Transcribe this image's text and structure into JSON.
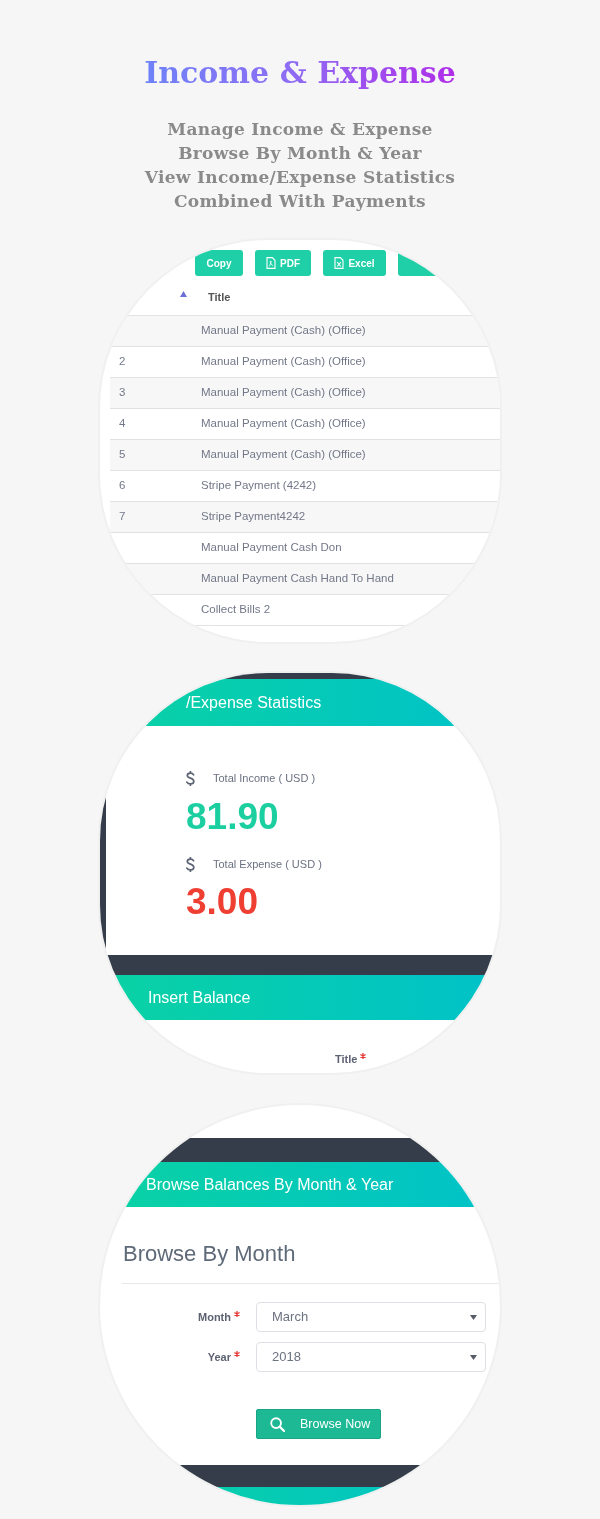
{
  "header": {
    "title": "Income & Expense",
    "features": [
      "Manage Income & Expense",
      "Browse By Month & Year",
      "View Income/Expense Statistics",
      "Combined With Payments"
    ]
  },
  "payments": {
    "toolbar": [
      {
        "kind": "copy",
        "label": "Copy"
      },
      {
        "kind": "pdf",
        "label": "PDF"
      },
      {
        "kind": "excel",
        "label": "Excel"
      },
      {
        "kind": "partial"
      }
    ],
    "columns": [
      {
        "sort_ascending": true
      },
      {
        "label": "Title"
      }
    ],
    "rows": [
      {
        "title": "Manual Payment (Cash) (Office)"
      },
      {
        "number": "2",
        "title": "Manual Payment (Cash) (Office)"
      },
      {
        "number": "3",
        "title": "Manual Payment (Cash) (Office)"
      },
      {
        "number": "4",
        "title": "Manual Payment (Cash) (Office)"
      },
      {
        "number": "5",
        "title": "Manual Payment (Cash) (Office)"
      },
      {
        "number": "6",
        "title": "Stripe Payment (4242)"
      },
      {
        "number": "7",
        "title": "Stripe Payment4242"
      },
      {
        "title": "Manual Payment Cash Don"
      },
      {
        "title": "Manual Payment Cash Hand To Hand"
      },
      {
        "title": "Collect Bills 2"
      }
    ]
  },
  "statistics": {
    "title": "/Expense Statistics",
    "totals": [
      {
        "label": "Total Income ( USD )",
        "amount": "81.90",
        "color": "#1ccfa0"
      },
      {
        "label": "Total Expense ( USD )",
        "amount": "3.00",
        "color": "#ef3f33"
      }
    ]
  },
  "insert_balance": {
    "title": "Insert Balance",
    "fields": [
      {
        "label": "Title",
        "required": true
      }
    ]
  },
  "browse": {
    "title": "Browse Balances By Month & Year",
    "heading": "Browse By Month",
    "fields": [
      {
        "label": "Month",
        "required": true,
        "value": "March"
      },
      {
        "label": "Year",
        "required": true,
        "value": "2018"
      }
    ],
    "button": {
      "label": "Browse Now"
    }
  }
}
